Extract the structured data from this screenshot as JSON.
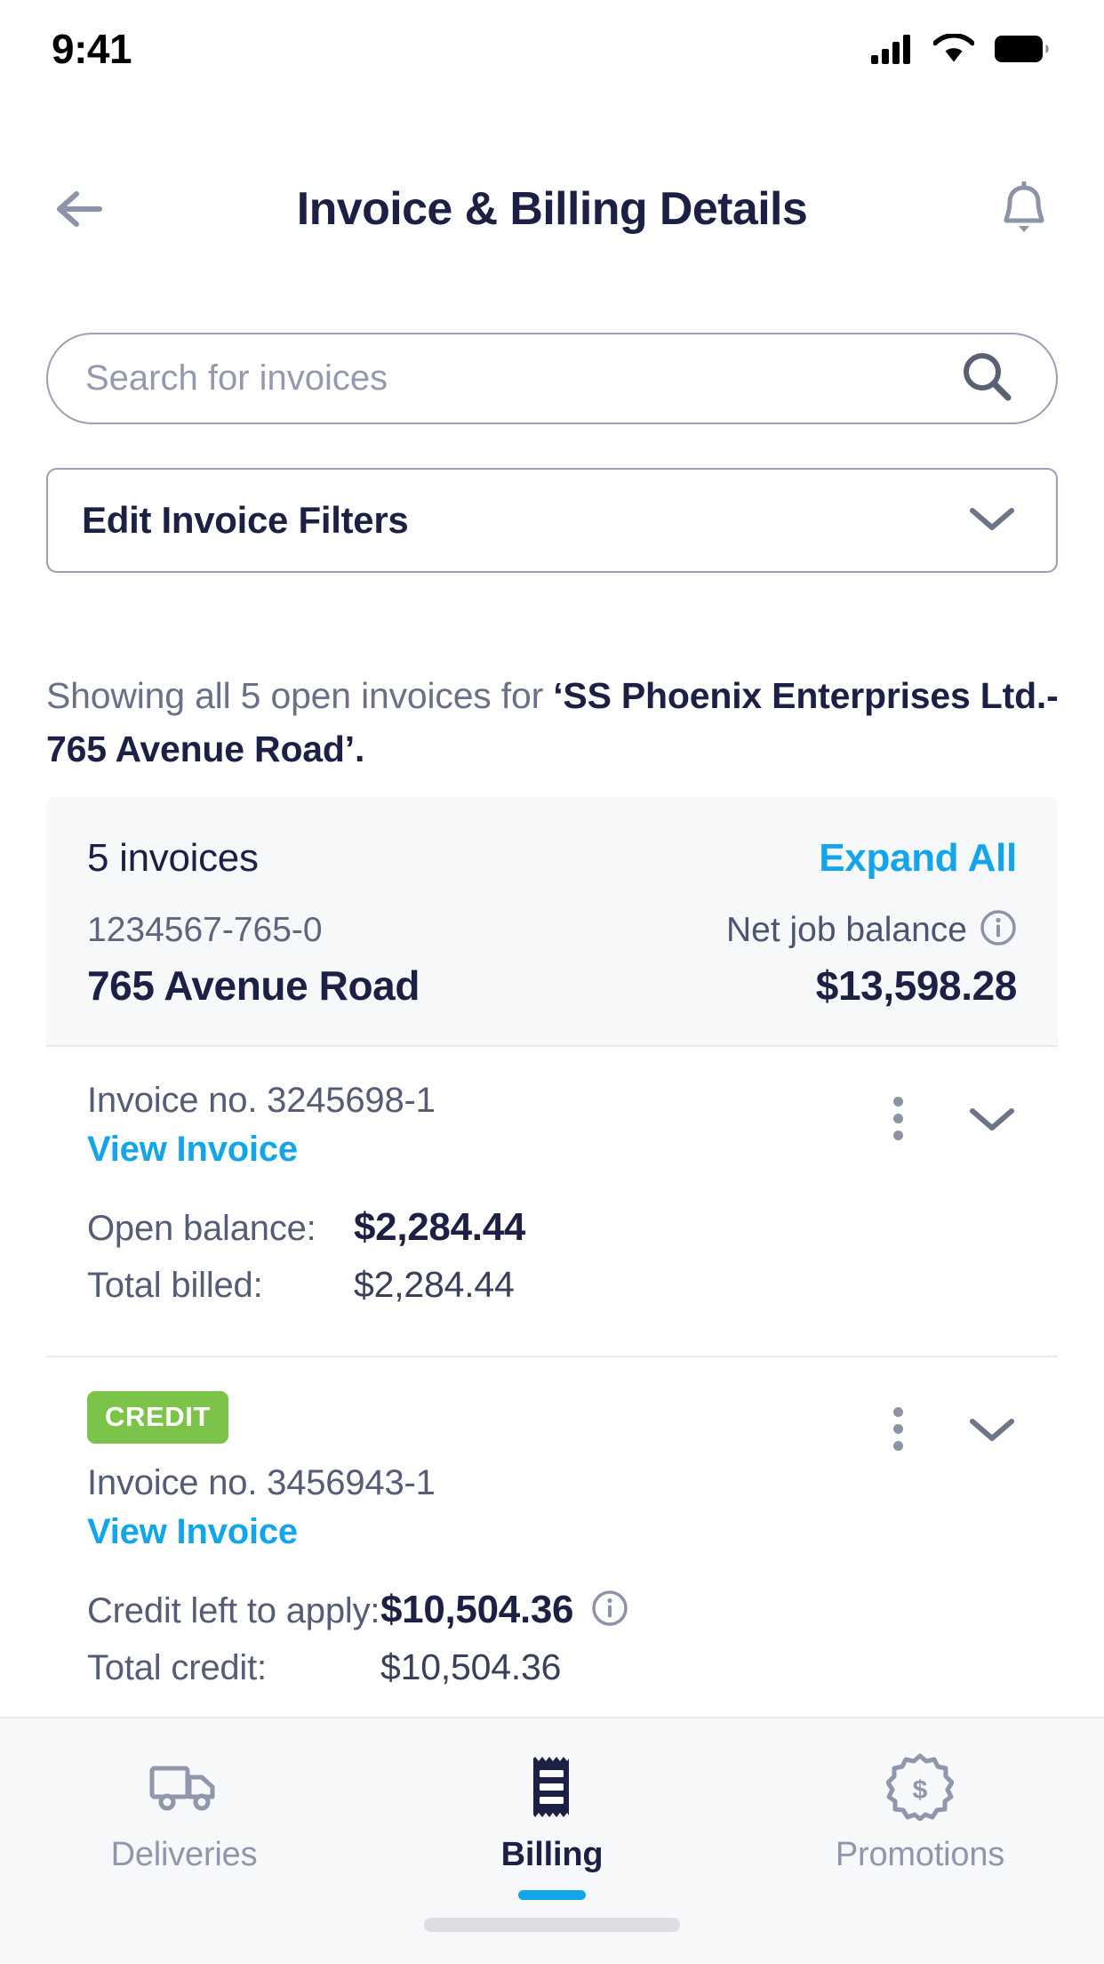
{
  "status_bar": {
    "time": "9:41",
    "icons": [
      "cellular-signal-icon",
      "wifi-icon",
      "battery-icon"
    ]
  },
  "header": {
    "back_icon": "arrow-left-icon",
    "title": "Invoice & Billing Details",
    "notification_icon": "bell-icon"
  },
  "search": {
    "placeholder": "Search for invoices",
    "value": "",
    "icon": "search-icon"
  },
  "filter": {
    "label": "Edit Invoice Filters",
    "chevron_icon": "chevron-down-icon"
  },
  "showing": {
    "prefix": "Showing all 5 open invoices for ",
    "account": "‘SS Phoenix Enterprises Ltd.- 765 Avenue Road’."
  },
  "card": {
    "invoice_count_label": "5 invoices",
    "expand_all_label": "Expand All",
    "job_number": "1234567-765-0",
    "net_balance_label": "Net job balance",
    "net_balance_info_icon": "info-icon",
    "job_address": "765 Avenue Road",
    "net_balance_amount": "$13,598.28",
    "invoices": [
      {
        "badge": null,
        "invoice_no": "Invoice no. 3245698-1",
        "view_link": "View Invoice",
        "menu_icon": "kebab-menu-icon",
        "chevron_icon": "chevron-down-icon",
        "rows": [
          {
            "label": "Open balance:",
            "value": "$2,284.44",
            "emphasis": true,
            "info": false
          },
          {
            "label": "Total billed:",
            "value": "$2,284.44",
            "emphasis": false,
            "info": false
          }
        ]
      },
      {
        "badge": "CREDIT",
        "invoice_no": "Invoice no. 3456943-1",
        "view_link": "View Invoice",
        "menu_icon": "kebab-menu-icon",
        "chevron_icon": "chevron-down-icon",
        "rows": [
          {
            "label": "Credit left to apply:",
            "value": "$10,504.36",
            "emphasis": true,
            "info": true
          },
          {
            "label": "Total credit:",
            "value": "$10,504.36",
            "emphasis": false,
            "info": false
          }
        ]
      }
    ]
  },
  "tabbar": {
    "tabs": [
      {
        "label": "Deliveries",
        "icon": "truck-icon",
        "active": false
      },
      {
        "label": "Billing",
        "icon": "receipt-icon",
        "active": true
      },
      {
        "label": "Promotions",
        "icon": "discount-badge-icon",
        "active": false
      }
    ]
  },
  "colors": {
    "accent_blue": "#12a5ec",
    "navy": "#1c2045",
    "credit_green": "#7cc34a",
    "muted_gray": "#6a7087",
    "card_head_bg": "#f6f8fa"
  }
}
